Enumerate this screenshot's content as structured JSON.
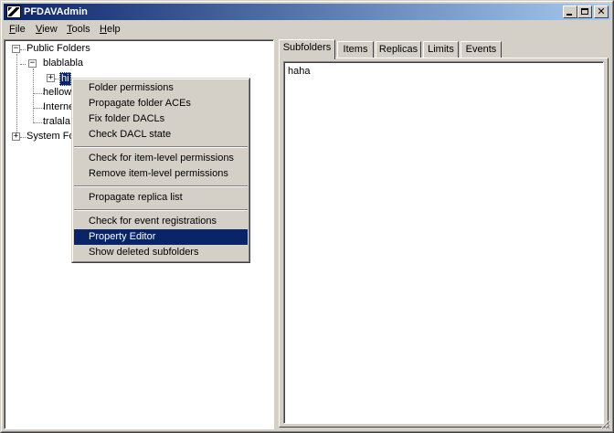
{
  "window": {
    "title": "PFDAVAdmin"
  },
  "menubar": {
    "items": [
      {
        "label": "File",
        "accel": "F",
        "rest": "ile"
      },
      {
        "label": "View",
        "accel": "V",
        "rest": "iew"
      },
      {
        "label": "Tools",
        "accel": "T",
        "rest": "ools"
      },
      {
        "label": "Help",
        "accel": "H",
        "rest": "elp"
      }
    ]
  },
  "tree": {
    "root": "Public Folders",
    "child": "blablabla",
    "selected": "hi",
    "visible_partial": [
      "hellow",
      "Interne",
      "tralala"
    ],
    "system": "System Fo"
  },
  "tabs": [
    {
      "label": "Subfolders",
      "active": true
    },
    {
      "label": "Items",
      "active": false
    },
    {
      "label": "Replicas",
      "active": false
    },
    {
      "label": "Limits",
      "active": false
    },
    {
      "label": "Events",
      "active": false
    }
  ],
  "subfolders": {
    "items": [
      "haha"
    ]
  },
  "context_menu": {
    "items": [
      "Folder permissions",
      "Propagate folder ACEs",
      "Fix folder DACLs",
      "Check DACL state",
      "Check for item-level permissions",
      "Remove item-level permissions",
      "Propagate replica list",
      "Check for event registrations",
      "Property Editor",
      "Show deleted subfolders"
    ],
    "highlighted": "Property Editor"
  },
  "colors": {
    "titlebar_start": "#0a246a",
    "titlebar_end": "#a6caf0",
    "highlight": "#0a246a",
    "face": "#d4d0c8"
  }
}
